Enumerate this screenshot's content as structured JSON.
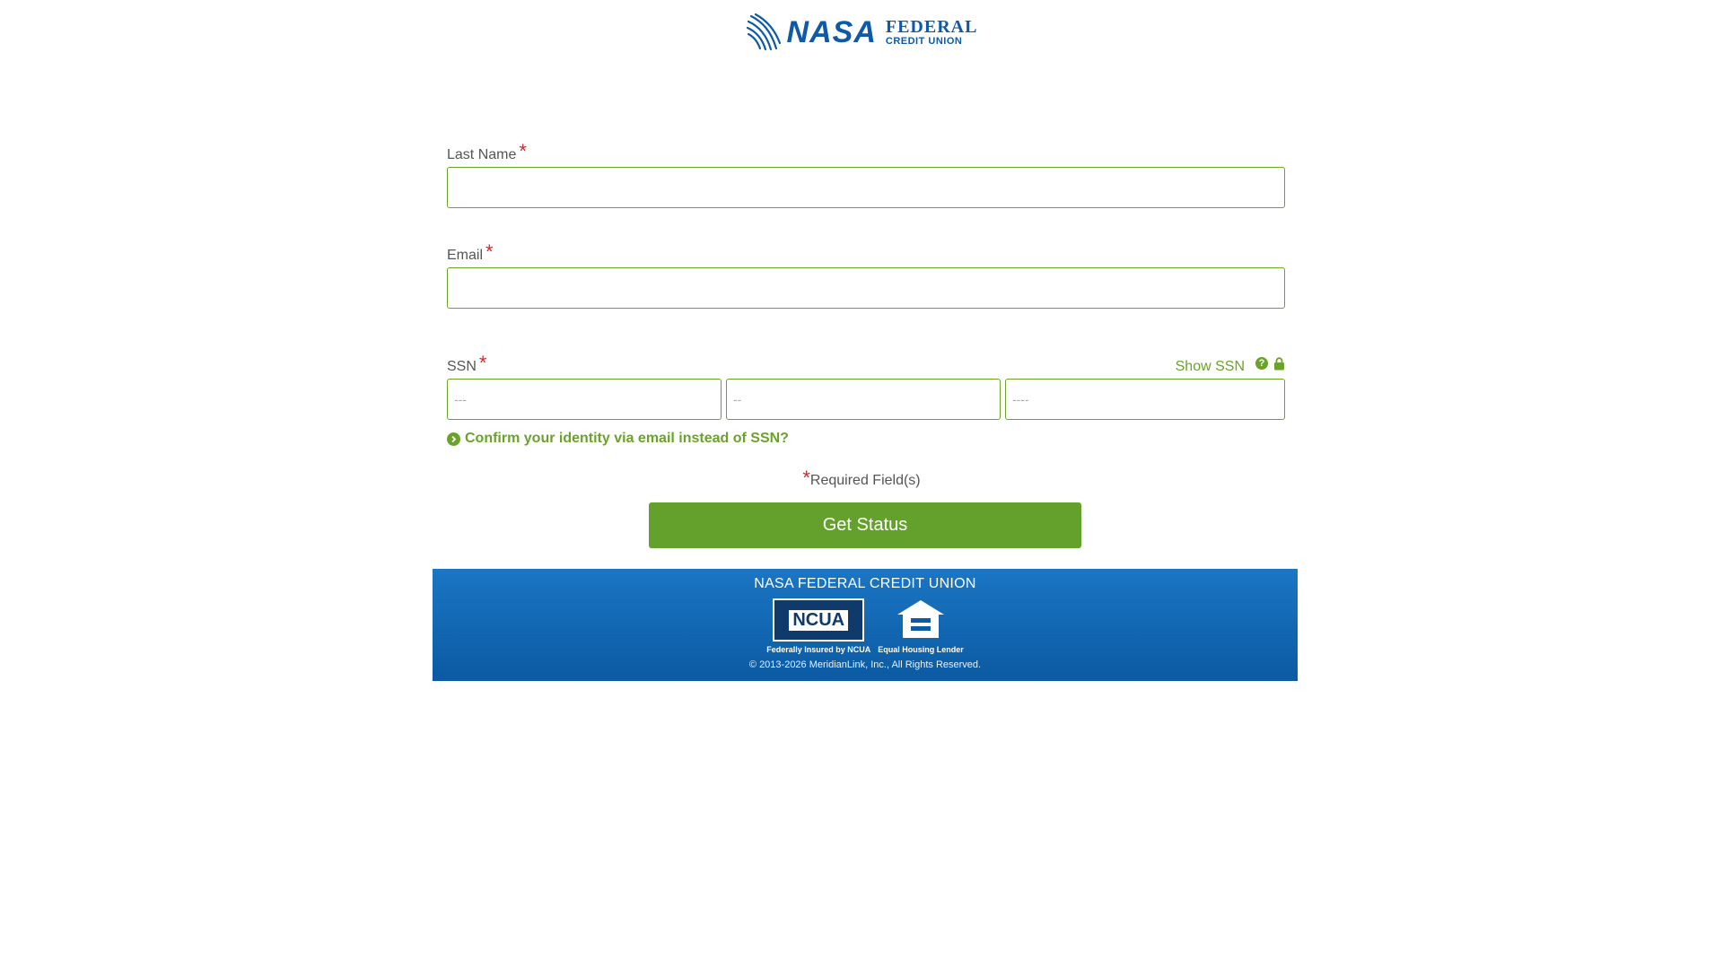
{
  "brand": {
    "logo_main": "NASA",
    "logo_line1": "FEDERAL",
    "logo_line2": "CREDIT UNION"
  },
  "form": {
    "last_name_label": "Last Name",
    "last_name_value": "",
    "email_label": "Email",
    "email_value": "",
    "ssn_label": "SSN",
    "show_ssn_label": "Show SSN",
    "help_glyph": "?",
    "ssn_part1_placeholder": "---",
    "ssn_part2_placeholder": "--",
    "ssn_part3_placeholder": "----",
    "required_marker": "*",
    "confirm_link": "Confirm your identity via email instead of SSN?",
    "required_note": "Required Field(s)",
    "submit_label": "Get Status"
  },
  "footer": {
    "title": "NASA FEDERAL CREDIT UNION",
    "ncua_text": "NCUA",
    "ncua_caption": "Federally Insured by NCUA",
    "ehl_caption": "Equal Housing Lender",
    "copyright": "© 2013-2026 MeridianLink, Inc., All Rights Reserved."
  },
  "colors": {
    "accent_green": "#64a12c",
    "brand_blue": "#0e5aa7",
    "required_red": "#d9252a"
  },
  "icons": [
    "nasa-logo-icon",
    "help-icon",
    "lock-icon",
    "chevron-right-circle-icon",
    "ncua-badge-icon",
    "equal-housing-icon"
  ]
}
